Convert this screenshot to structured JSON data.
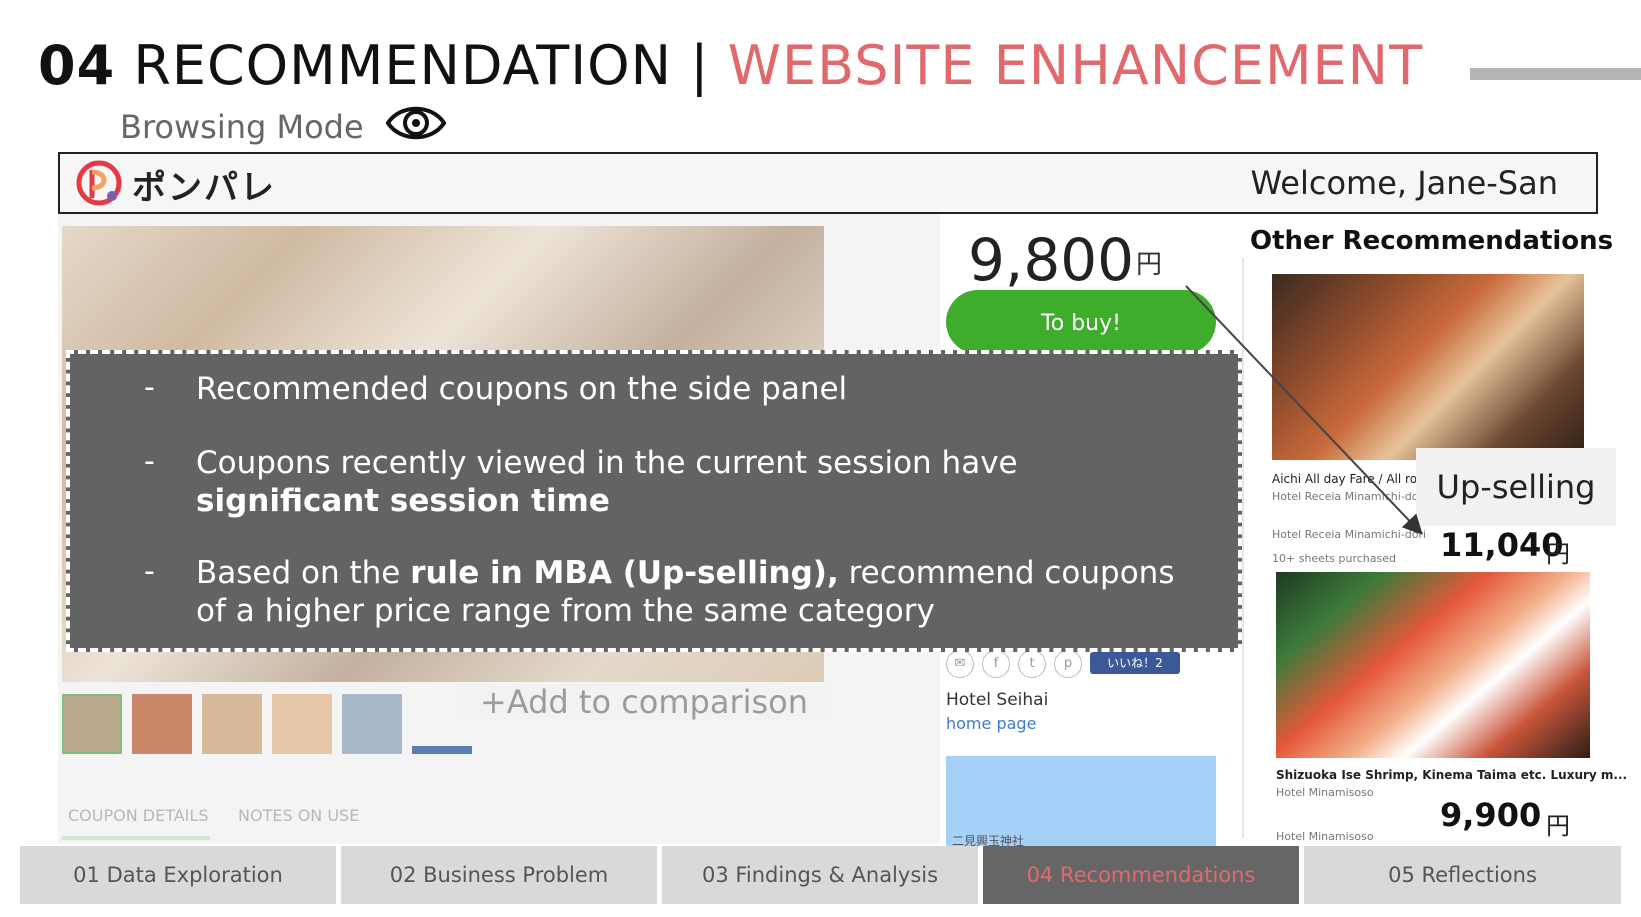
{
  "title": {
    "number": "04",
    "main": "RECOMMENDATION",
    "separator": "|",
    "accent": "WEBSITE ENHANCEMENT"
  },
  "subtitle": "Browsing Mode",
  "icons": {
    "mode": "eye-icon",
    "logo": "ponpare-logo"
  },
  "colors": {
    "accent": "#e0696d",
    "buy": "#3ead2b",
    "overlay": "#636363"
  },
  "header": {
    "logo_text": "ポンパレ",
    "welcome": "Welcome, Jane-San"
  },
  "product": {
    "price": "9,800",
    "currency": "円",
    "buy_label": "To buy!",
    "compare_label": "+Add to comparison",
    "tabs": [
      "COUPON DETAILS",
      "NOTES ON USE"
    ],
    "like_label": "いいね！2",
    "hotel_name": "Hotel Seihai",
    "home_link": "home page",
    "map_label": "二見興玉神社"
  },
  "sidebar": {
    "title": "Other Recommendations",
    "rec1": {
      "title": "Aichi All day Fare / All ro",
      "hotel": "Hotel Receia Minamichi-dori",
      "hotel2": "Hotel Receia Minamichi-dori",
      "sold": "10+ sheets purchased",
      "price": "11,040",
      "currency": "円",
      "tag": "Up-selling"
    },
    "rec2": {
      "title": "Shizuoka Ise Shrimp, Kinema Taima etc. Luxury m...",
      "hotel": "Hotel Minamisoso",
      "hotel2": "Hotel Minamisoso",
      "price": "9,900",
      "currency": "円"
    }
  },
  "overlay": {
    "bullets": [
      {
        "dash": "-",
        "pre": "Recommended coupons on the side panel",
        "bold": "",
        "post": ""
      },
      {
        "dash": "-",
        "pre": "Coupons recently viewed in the current session have ",
        "bold": "significant session time",
        "post": ""
      },
      {
        "dash": "-",
        "pre": "Based on the ",
        "bold": "rule in MBA (Up-selling),",
        "post": " recommend coupons of a higher price range from the same category"
      }
    ]
  },
  "nav": {
    "items": [
      {
        "label": "01 Data Exploration",
        "active": false
      },
      {
        "label": "02 Business Problem",
        "active": false
      },
      {
        "label": "03 Findings & Analysis",
        "active": false
      },
      {
        "label": "04 Recommendations",
        "active": true
      },
      {
        "label": "05 Reflections",
        "active": false
      }
    ]
  }
}
